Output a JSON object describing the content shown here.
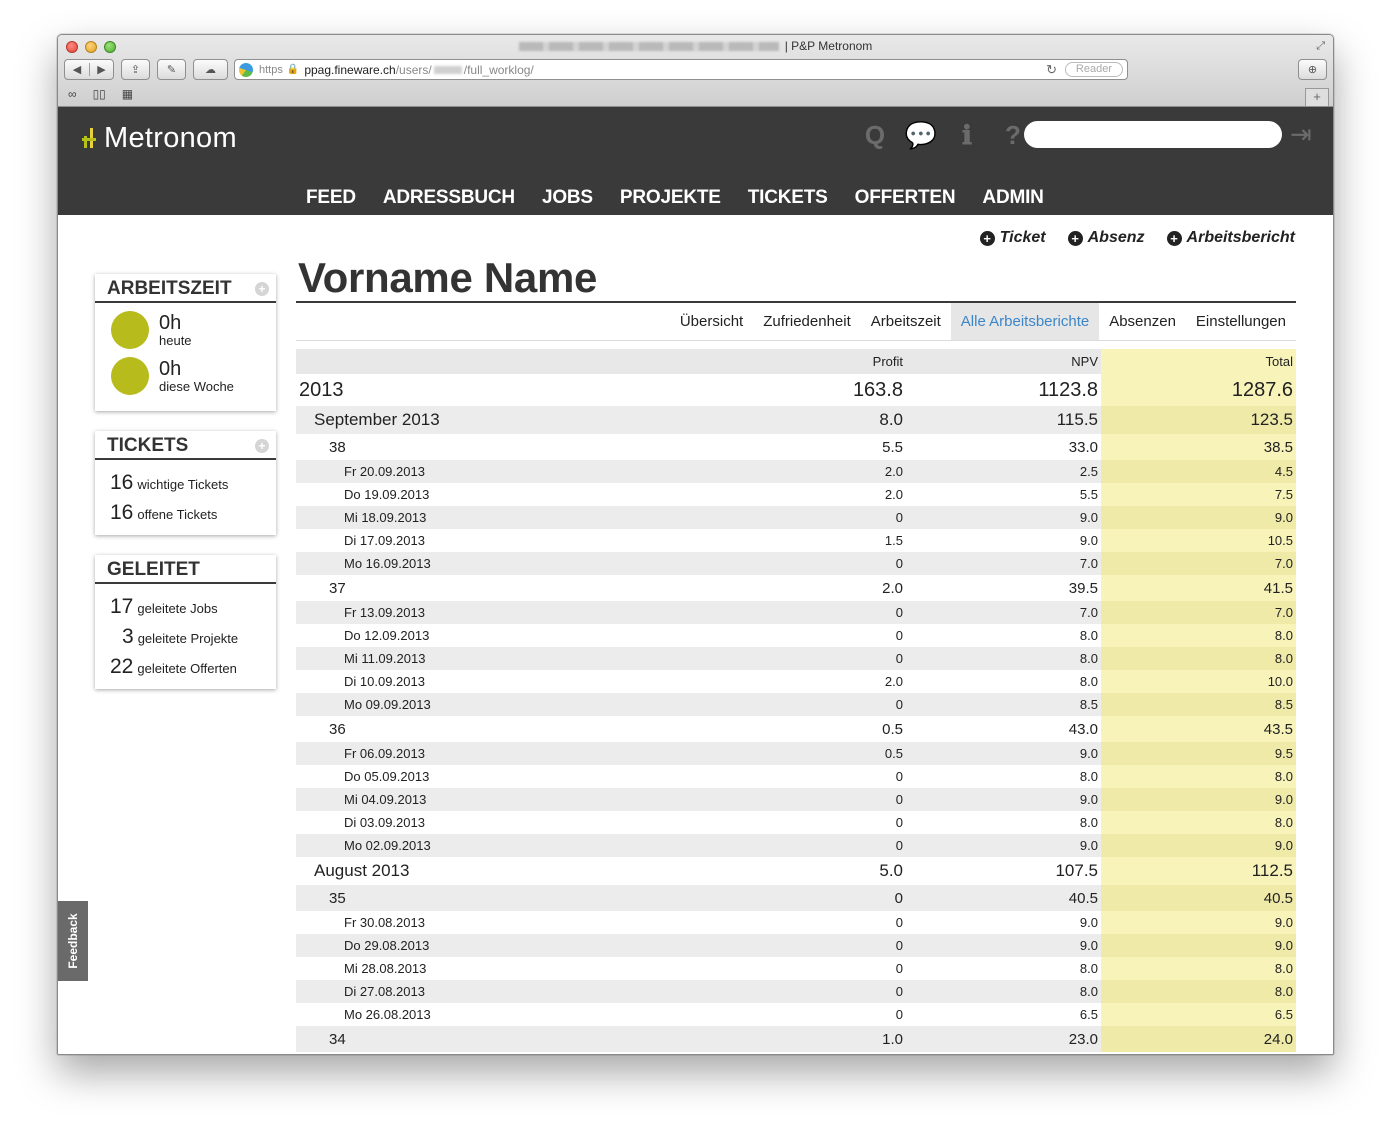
{
  "browser": {
    "title": "| P&P Metronom",
    "url_scheme": "https",
    "url_host": "ppag.fineware.ch",
    "url_path_prefix": "/users/",
    "url_path_suffix": "/full_worklog/",
    "reader_label": "Reader"
  },
  "app": {
    "logo_text": "Metronom",
    "nav": [
      "FEED",
      "ADRESSBUCH",
      "JOBS",
      "PROJEKTE",
      "TICKETS",
      "OFFERTEN",
      "ADMIN"
    ],
    "header_icons": [
      "search-icon",
      "chat-icon",
      "info-icon",
      "help-icon"
    ],
    "search_placeholder": ""
  },
  "quick_actions": [
    "Ticket",
    "Absenz",
    "Arbeitsbericht"
  ],
  "sidebar": {
    "arbeitszeit": {
      "title": "ARBEITSZEIT",
      "today_value": "0h",
      "today_label": "heute",
      "week_value": "0h",
      "week_label": "diese Woche",
      "dot_color": "#b7bb1c"
    },
    "tickets": {
      "title": "TICKETS",
      "items": [
        {
          "count": "16",
          "label": "wichtige Tickets"
        },
        {
          "count": "16",
          "label": "offene Tickets"
        }
      ]
    },
    "geleitet": {
      "title": "GELEITET",
      "items": [
        {
          "count": "17",
          "label": "geleitete Jobs"
        },
        {
          "count": "3",
          "label": "geleitete Projekte"
        },
        {
          "count": "22",
          "label": "geleitete Offerten"
        }
      ]
    }
  },
  "person": {
    "name": "Vorname Name"
  },
  "subnav": {
    "tabs": [
      "Übersicht",
      "Zufriedenheit",
      "Arbeitszeit",
      "Alle Arbeitsberichte",
      "Absenzen",
      "Einstellungen"
    ],
    "active": "Alle Arbeitsberichte",
    "active_color": "#3c86c8"
  },
  "worklog": {
    "columns": [
      "Profit",
      "NPV",
      "Total"
    ],
    "total_bg": "#f8f3b9",
    "rows": [
      {
        "level": "year",
        "label": "2013",
        "profit": "163.8",
        "npv": "1123.8",
        "total": "1287.6"
      },
      {
        "level": "month",
        "label": "September 2013",
        "profit": "8.0",
        "npv": "115.5",
        "total": "123.5"
      },
      {
        "level": "week",
        "label": "38",
        "profit": "5.5",
        "npv": "33.0",
        "total": "38.5"
      },
      {
        "level": "day",
        "label": "Fr 20.09.2013",
        "profit": "2.0",
        "npv": "2.5",
        "total": "4.5"
      },
      {
        "level": "day",
        "label": "Do 19.09.2013",
        "profit": "2.0",
        "npv": "5.5",
        "total": "7.5"
      },
      {
        "level": "day",
        "label": "Mi 18.09.2013",
        "profit": "0",
        "npv": "9.0",
        "total": "9.0"
      },
      {
        "level": "day",
        "label": "Di 17.09.2013",
        "profit": "1.5",
        "npv": "9.0",
        "total": "10.5"
      },
      {
        "level": "day",
        "label": "Mo 16.09.2013",
        "profit": "0",
        "npv": "7.0",
        "total": "7.0"
      },
      {
        "level": "week",
        "label": "37",
        "profit": "2.0",
        "npv": "39.5",
        "total": "41.5"
      },
      {
        "level": "day",
        "label": "Fr 13.09.2013",
        "profit": "0",
        "npv": "7.0",
        "total": "7.0"
      },
      {
        "level": "day",
        "label": "Do 12.09.2013",
        "profit": "0",
        "npv": "8.0",
        "total": "8.0"
      },
      {
        "level": "day",
        "label": "Mi 11.09.2013",
        "profit": "0",
        "npv": "8.0",
        "total": "8.0"
      },
      {
        "level": "day",
        "label": "Di 10.09.2013",
        "profit": "2.0",
        "npv": "8.0",
        "total": "10.0"
      },
      {
        "level": "day",
        "label": "Mo 09.09.2013",
        "profit": "0",
        "npv": "8.5",
        "total": "8.5"
      },
      {
        "level": "week",
        "label": "36",
        "profit": "0.5",
        "npv": "43.0",
        "total": "43.5"
      },
      {
        "level": "day",
        "label": "Fr 06.09.2013",
        "profit": "0.5",
        "npv": "9.0",
        "total": "9.5"
      },
      {
        "level": "day",
        "label": "Do 05.09.2013",
        "profit": "0",
        "npv": "8.0",
        "total": "8.0"
      },
      {
        "level": "day",
        "label": "Mi 04.09.2013",
        "profit": "0",
        "npv": "9.0",
        "total": "9.0"
      },
      {
        "level": "day",
        "label": "Di 03.09.2013",
        "profit": "0",
        "npv": "8.0",
        "total": "8.0"
      },
      {
        "level": "day",
        "label": "Mo 02.09.2013",
        "profit": "0",
        "npv": "9.0",
        "total": "9.0"
      },
      {
        "level": "month",
        "label": "August 2013",
        "profit": "5.0",
        "npv": "107.5",
        "total": "112.5"
      },
      {
        "level": "week",
        "label": "35",
        "profit": "0",
        "npv": "40.5",
        "total": "40.5"
      },
      {
        "level": "day",
        "label": "Fr 30.08.2013",
        "profit": "0",
        "npv": "9.0",
        "total": "9.0"
      },
      {
        "level": "day",
        "label": "Do 29.08.2013",
        "profit": "0",
        "npv": "9.0",
        "total": "9.0"
      },
      {
        "level": "day",
        "label": "Mi 28.08.2013",
        "profit": "0",
        "npv": "8.0",
        "total": "8.0"
      },
      {
        "level": "day",
        "label": "Di 27.08.2013",
        "profit": "0",
        "npv": "8.0",
        "total": "8.0"
      },
      {
        "level": "day",
        "label": "Mo 26.08.2013",
        "profit": "0",
        "npv": "6.5",
        "total": "6.5"
      },
      {
        "level": "week",
        "label": "34",
        "profit": "1.0",
        "npv": "23.0",
        "total": "24.0"
      }
    ]
  },
  "feedback_label": "Feedback"
}
